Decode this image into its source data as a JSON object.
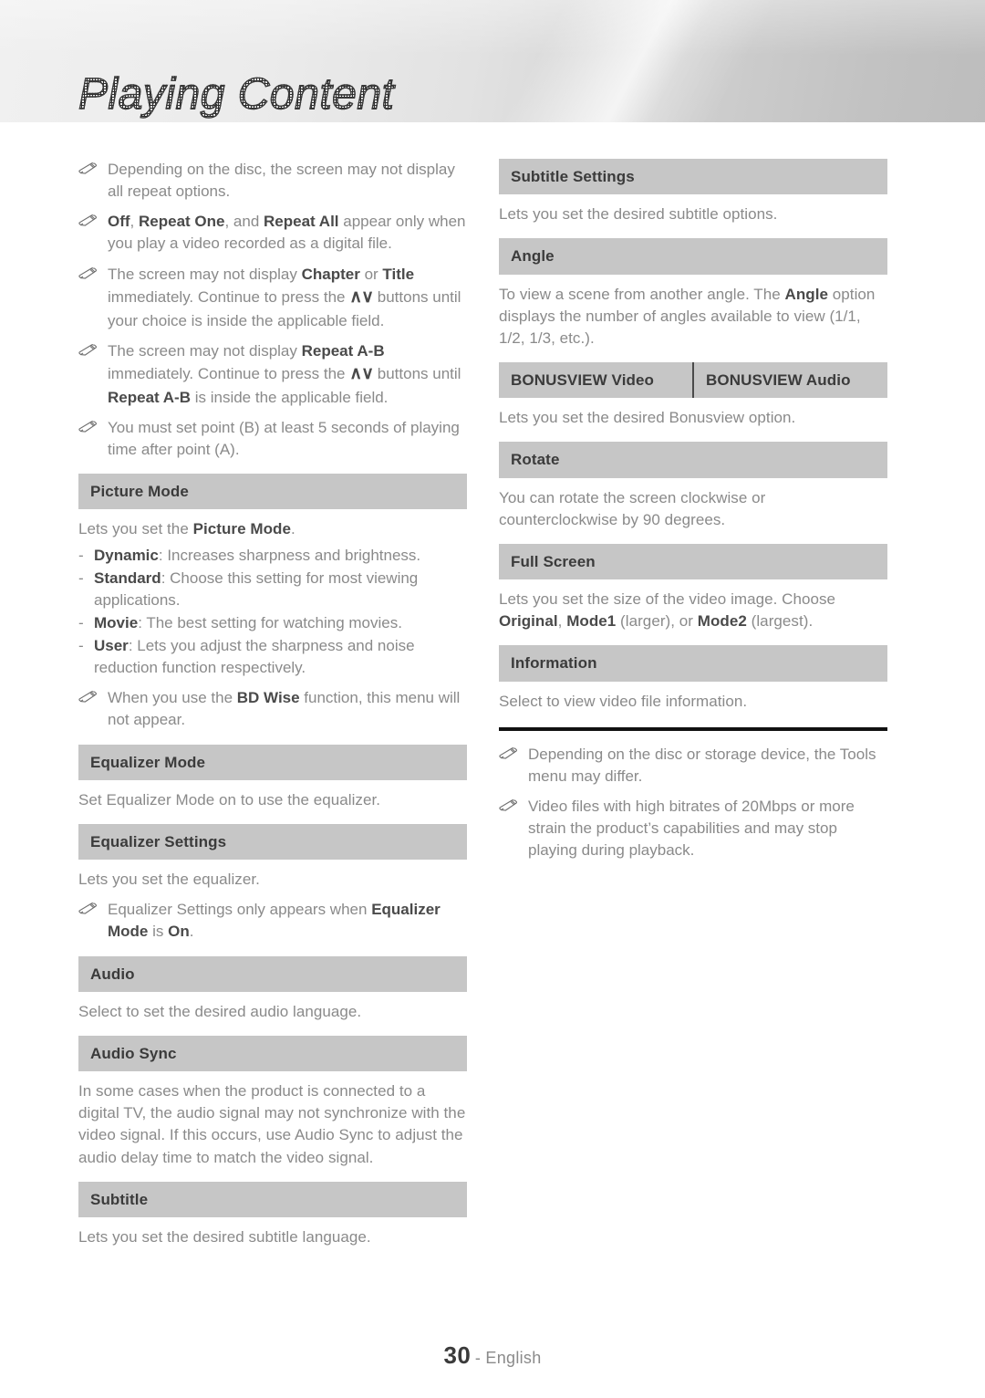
{
  "header": {
    "title": "Playing Content"
  },
  "footer": {
    "page_number": "30",
    "separator_and_language": "- English"
  },
  "icons": {
    "note_bullet": "pencil-icon"
  },
  "left_column": {
    "top_notes": [
      "Depending on the disc, the screen may not display all repeat options.",
      "Off, Repeat One, and Repeat All appear only when you play a video recorded as a digital file.",
      "The screen may not display Chapter or Title immediately. Continue to press the ∧∨ buttons until your choice is inside the applicable field.",
      "The screen may not display Repeat A-B immediately. Continue to press the ∧∨ buttons until Repeat A-B is inside the applicable field.",
      "You must set point (B) at least 5 seconds of playing time after point (A)."
    ],
    "sections": [
      {
        "title": "Picture Mode",
        "intro": "Lets you set the Picture Mode.",
        "dash_items": [
          {
            "term": "Dynamic",
            "desc": ": Increases sharpness and brightness."
          },
          {
            "term": "Standard",
            "desc": ": Choose this setting for most viewing applications."
          },
          {
            "term": "Movie",
            "desc": ": The best setting for watching movies."
          },
          {
            "term": "User",
            "desc": ": Lets you adjust the sharpness and noise reduction function respectively."
          }
        ],
        "note": "When you use the BD Wise function, this menu will not appear."
      },
      {
        "title": "Equalizer Mode",
        "body": "Set Equalizer Mode on to use the equalizer."
      },
      {
        "title": "Equalizer Settings",
        "body": "Lets you set the equalizer.",
        "note": "Equalizer Settings only appears when Equalizer Mode is On."
      },
      {
        "title": "Audio",
        "body": "Select to set the desired audio language."
      },
      {
        "title": "Audio Sync",
        "body": "In some cases when the product is connected to a digital TV, the audio signal may not synchronize with the video signal. If this occurs, use Audio Sync to adjust the audio delay time to match the video signal."
      },
      {
        "title": "Subtitle",
        "body": "Lets you set the desired subtitle language."
      }
    ]
  },
  "right_column": {
    "sections": [
      {
        "title": "Subtitle Settings",
        "body": "Lets you set the desired subtitle options."
      },
      {
        "title": "Angle",
        "body": "To view a scene from another angle. The Angle option displays the number of angles available to view (1/1, 1/2, 1/3, etc.)."
      },
      {
        "title_left": "BONUSVIEW Video",
        "title_right": "BONUSVIEW Audio",
        "body": "Lets you set the desired Bonusview option."
      },
      {
        "title": "Rotate",
        "body": "You can rotate the screen clockwise or counterclockwise by 90 degrees."
      },
      {
        "title": "Full Screen",
        "body": "Lets you set the size of the video image. Choose Original, Mode1 (larger), or Mode2 (largest)."
      },
      {
        "title": "Information",
        "body": "Select to view video file information."
      }
    ],
    "bottom_notes": [
      "Depending on the disc or storage device, the Tools menu may differ.",
      "Video files with high bitrates of 20Mbps or more strain the product’s capabilities and may stop playing during playback."
    ]
  },
  "colors": {
    "section_bar": "#c6c6c6",
    "body_text": "#8a8a8a",
    "bold_text": "#4a4a4a",
    "rule": "#111111"
  }
}
